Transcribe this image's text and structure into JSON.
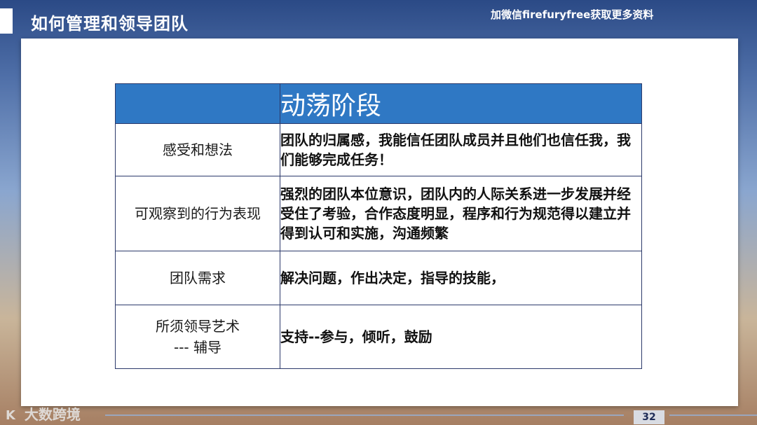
{
  "header": {
    "title": "如何管理和领导团队",
    "watermark": "加微信firefuryfree获取更多资料"
  },
  "table": {
    "heading": "动荡阶段",
    "rows": [
      {
        "label": "感受和想法",
        "desc": "团队的归属感，我能信任团队成员并且他们也信任我，我们能够完成任务！"
      },
      {
        "label": "可观察到的行为表现",
        "desc": "强烈的团队本位意识，团队内的人际关系进一步发展并经受住了考验，合作态度明显，程序和行为规范得以建立并得到认可和实施，沟通频繁"
      },
      {
        "label": "团队需求",
        "desc": "解决问题，作出决定，指导的技能，"
      },
      {
        "label_line1": "所须领导艺术",
        "label_line2": "--- 辅导",
        "desc": "支持--参与，倾听，鼓励"
      }
    ]
  },
  "footer": {
    "logo_text": "大数跨境",
    "logo_icon": "K",
    "page_number": "32"
  }
}
